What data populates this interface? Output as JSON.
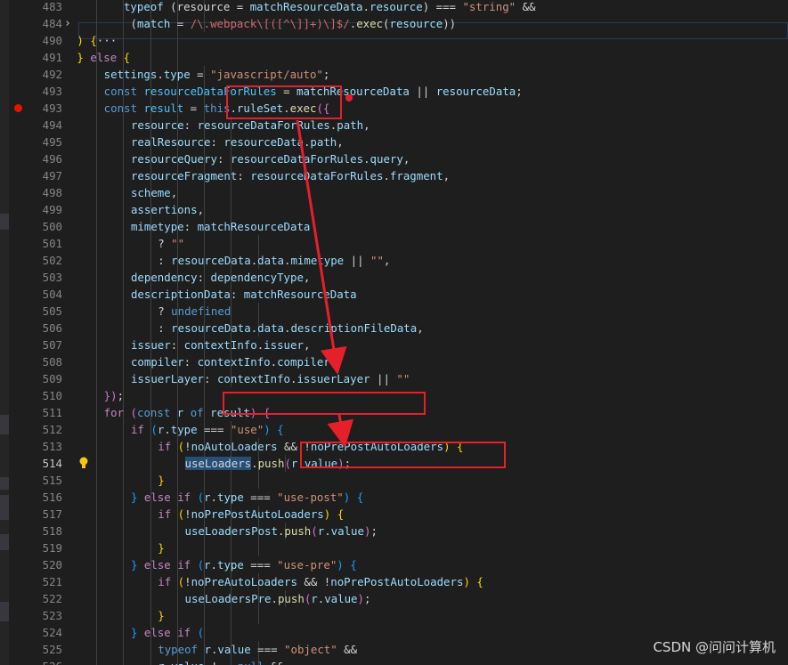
{
  "editor": {
    "lines": [
      {
        "n": "483",
        "tokens": [
          [
            "p",
            "    "
          ],
          [
            "v",
            "typeof"
          ],
          [
            "p",
            " (resource "
          ],
          [
            "p",
            "= "
          ],
          [
            "v",
            "matchResourceData"
          ],
          [
            "p",
            "."
          ],
          [
            "v",
            "resource"
          ],
          [
            "p",
            ") "
          ],
          [
            "p",
            "=== "
          ],
          [
            "s",
            "\"string\""
          ],
          [
            "p",
            " &&"
          ]
        ]
      },
      {
        "n": "484",
        "fold": "›",
        "tokens": [
          [
            "p",
            "    ("
          ],
          [
            "v",
            "match"
          ],
          [
            "p",
            " = "
          ],
          [
            "r",
            "/\\.webpack\\[([^\\]]+)\\]$/"
          ],
          [
            "p",
            "."
          ],
          [
            "f",
            "exec"
          ],
          [
            "p",
            "("
          ],
          [
            "v",
            "resource"
          ],
          [
            "p",
            "))"
          ]
        ]
      },
      {
        "n": "490",
        "tokens": [
          [
            "b1",
            ") {"
          ],
          [
            "p",
            "···"
          ]
        ]
      },
      {
        "n": "491",
        "tokens": [
          [
            "b1",
            "} "
          ],
          [
            "kc",
            "else"
          ],
          [
            "b1",
            " {"
          ]
        ]
      },
      {
        "n": "492",
        "tokens": [
          [
            "v",
            "settings"
          ],
          [
            "p",
            "."
          ],
          [
            "v",
            "type"
          ],
          [
            "p",
            " = "
          ],
          [
            "s",
            "\"javascript/auto\""
          ],
          [
            "p",
            ";"
          ]
        ]
      },
      {
        "n": "493",
        "tokens": [
          [
            "k",
            "const"
          ],
          [
            "p",
            " "
          ],
          [
            "cst",
            "resourceDataForRules"
          ],
          [
            "p",
            " = "
          ],
          [
            "v",
            "matchResourceData"
          ],
          [
            "p",
            " || "
          ],
          [
            "v",
            "resourceData"
          ],
          [
            "p",
            ";"
          ]
        ]
      },
      {
        "n": "493",
        "bp": true,
        "tokens": [
          [
            "k",
            "const"
          ],
          [
            "p",
            " "
          ],
          [
            "cst",
            "result"
          ],
          [
            "p",
            " = "
          ],
          [
            "k",
            "this"
          ],
          [
            "p",
            "."
          ],
          [
            "v",
            "ruleSet"
          ],
          [
            "p",
            "."
          ],
          [
            "f",
            "exec"
          ],
          [
            "b2",
            "({"
          ]
        ]
      },
      {
        "n": "494",
        "tokens": [
          [
            "v",
            "resource"
          ],
          [
            "p",
            ": "
          ],
          [
            "v",
            "resourceDataForRules"
          ],
          [
            "p",
            "."
          ],
          [
            "v",
            "path"
          ],
          [
            "p",
            ","
          ]
        ]
      },
      {
        "n": "495",
        "tokens": [
          [
            "v",
            "realResource"
          ],
          [
            "p",
            ": "
          ],
          [
            "v",
            "resourceData"
          ],
          [
            "p",
            "."
          ],
          [
            "v",
            "path"
          ],
          [
            "p",
            ","
          ]
        ]
      },
      {
        "n": "496",
        "tokens": [
          [
            "v",
            "resourceQuery"
          ],
          [
            "p",
            ": "
          ],
          [
            "v",
            "resourceDataForRules"
          ],
          [
            "p",
            "."
          ],
          [
            "v",
            "query"
          ],
          [
            "p",
            ","
          ]
        ]
      },
      {
        "n": "497",
        "tokens": [
          [
            "v",
            "resourceFragment"
          ],
          [
            "p",
            ": "
          ],
          [
            "v",
            "resourceDataForRules"
          ],
          [
            "p",
            "."
          ],
          [
            "v",
            "fragment"
          ],
          [
            "p",
            ","
          ]
        ]
      },
      {
        "n": "498",
        "tokens": [
          [
            "v",
            "scheme"
          ],
          [
            "p",
            ","
          ]
        ]
      },
      {
        "n": "499",
        "tokens": [
          [
            "v",
            "assertions"
          ],
          [
            "p",
            ","
          ]
        ]
      },
      {
        "n": "500",
        "tokens": [
          [
            "v",
            "mimetype"
          ],
          [
            "p",
            ": "
          ],
          [
            "v",
            "matchResourceData"
          ]
        ]
      },
      {
        "n": "501",
        "tokens": [
          [
            "p",
            "? "
          ],
          [
            "s",
            "\"\""
          ]
        ]
      },
      {
        "n": "502",
        "tokens": [
          [
            "p",
            ": "
          ],
          [
            "v",
            "resourceData"
          ],
          [
            "p",
            "."
          ],
          [
            "v",
            "data"
          ],
          [
            "p",
            "."
          ],
          [
            "v",
            "mimetype"
          ],
          [
            "p",
            " || "
          ],
          [
            "s",
            "\"\""
          ],
          [
            "p",
            ","
          ]
        ]
      },
      {
        "n": "503",
        "tokens": [
          [
            "v",
            "dependency"
          ],
          [
            "p",
            ": "
          ],
          [
            "v",
            "dependencyType"
          ],
          [
            "p",
            ","
          ]
        ]
      },
      {
        "n": "504",
        "tokens": [
          [
            "v",
            "descriptionData"
          ],
          [
            "p",
            ": "
          ],
          [
            "v",
            "matchResourceData"
          ]
        ]
      },
      {
        "n": "505",
        "tokens": [
          [
            "p",
            "? "
          ],
          [
            "k",
            "undefined"
          ]
        ]
      },
      {
        "n": "506",
        "tokens": [
          [
            "p",
            ": "
          ],
          [
            "v",
            "resourceData"
          ],
          [
            "p",
            "."
          ],
          [
            "v",
            "data"
          ],
          [
            "p",
            "."
          ],
          [
            "v",
            "descriptionFileData"
          ],
          [
            "p",
            ","
          ]
        ]
      },
      {
        "n": "507",
        "tokens": [
          [
            "v",
            "issuer"
          ],
          [
            "p",
            ": "
          ],
          [
            "v",
            "contextInfo"
          ],
          [
            "p",
            "."
          ],
          [
            "v",
            "issuer"
          ],
          [
            "p",
            ","
          ]
        ]
      },
      {
        "n": "508",
        "tokens": [
          [
            "v",
            "compiler"
          ],
          [
            "p",
            ": "
          ],
          [
            "v",
            "contextInfo"
          ],
          [
            "p",
            "."
          ],
          [
            "v",
            "compiler"
          ],
          [
            "p",
            ","
          ]
        ]
      },
      {
        "n": "509",
        "tokens": [
          [
            "v",
            "issuerLayer"
          ],
          [
            "p",
            ": "
          ],
          [
            "v",
            "contextInfo"
          ],
          [
            "p",
            "."
          ],
          [
            "v",
            "issuerLayer"
          ],
          [
            "p",
            " || "
          ],
          [
            "s",
            "\"\""
          ]
        ]
      },
      {
        "n": "510",
        "tokens": [
          [
            "b2",
            "})"
          ],
          [
            "p",
            ";"
          ]
        ]
      },
      {
        "n": "511",
        "tokens": [
          [
            "kc",
            "for"
          ],
          [
            "p",
            " "
          ],
          [
            "b2",
            "("
          ],
          [
            "k",
            "const"
          ],
          [
            "p",
            " "
          ],
          [
            "v",
            "r"
          ],
          [
            "p",
            " "
          ],
          [
            "k",
            "of"
          ],
          [
            "p",
            " "
          ],
          [
            "v",
            "result"
          ],
          [
            "b2",
            ")"
          ],
          [
            "p",
            " "
          ],
          [
            "b2",
            "{"
          ]
        ]
      },
      {
        "n": "512",
        "tokens": [
          [
            "kc",
            "if"
          ],
          [
            "p",
            " "
          ],
          [
            "b3",
            "("
          ],
          [
            "v",
            "r"
          ],
          [
            "p",
            "."
          ],
          [
            "v",
            "type"
          ],
          [
            "p",
            " === "
          ],
          [
            "s",
            "\"use\""
          ],
          [
            "b3",
            ")"
          ],
          [
            "p",
            " "
          ],
          [
            "b3",
            "{"
          ]
        ]
      },
      {
        "n": "513",
        "tokens": [
          [
            "kc",
            "if"
          ],
          [
            "p",
            " "
          ],
          [
            "b1",
            "("
          ],
          [
            "p",
            "!"
          ],
          [
            "v",
            "noAutoLoaders"
          ],
          [
            "p",
            " && !"
          ],
          [
            "v",
            "noPrePostAutoLoaders"
          ],
          [
            "b1",
            ")"
          ],
          [
            "p",
            " "
          ],
          [
            "b1",
            "{"
          ]
        ]
      },
      {
        "n": "514",
        "active": true,
        "bulb": true,
        "tokens": [
          [
            "hl",
            "useLoaders"
          ],
          [
            "p",
            "."
          ],
          [
            "f",
            "push"
          ],
          [
            "b2",
            "("
          ],
          [
            "v",
            "r"
          ],
          [
            "p",
            "."
          ],
          [
            "v",
            "value"
          ],
          [
            "b2",
            ")"
          ],
          [
            "p",
            ";"
          ]
        ]
      },
      {
        "n": "515",
        "tokens": [
          [
            "b1",
            "}"
          ]
        ]
      },
      {
        "n": "516",
        "tokens": [
          [
            "b3",
            "}"
          ],
          [
            "p",
            " "
          ],
          [
            "kc",
            "else if"
          ],
          [
            "p",
            " "
          ],
          [
            "b3",
            "("
          ],
          [
            "v",
            "r"
          ],
          [
            "p",
            "."
          ],
          [
            "v",
            "type"
          ],
          [
            "p",
            " === "
          ],
          [
            "s",
            "\"use-post\""
          ],
          [
            "b3",
            ")"
          ],
          [
            "p",
            " "
          ],
          [
            "b3",
            "{"
          ]
        ]
      },
      {
        "n": "517",
        "tokens": [
          [
            "kc",
            "if"
          ],
          [
            "p",
            " "
          ],
          [
            "b1",
            "("
          ],
          [
            "p",
            "!"
          ],
          [
            "v",
            "noPrePostAutoLoaders"
          ],
          [
            "b1",
            ")"
          ],
          [
            "p",
            " "
          ],
          [
            "b1",
            "{"
          ]
        ]
      },
      {
        "n": "518",
        "tokens": [
          [
            "v",
            "useLoadersPost"
          ],
          [
            "p",
            "."
          ],
          [
            "f",
            "push"
          ],
          [
            "b2",
            "("
          ],
          [
            "v",
            "r"
          ],
          [
            "p",
            "."
          ],
          [
            "v",
            "value"
          ],
          [
            "b2",
            ")"
          ],
          [
            "p",
            ";"
          ]
        ]
      },
      {
        "n": "519",
        "tokens": [
          [
            "b1",
            "}"
          ]
        ]
      },
      {
        "n": "520",
        "tokens": [
          [
            "b3",
            "}"
          ],
          [
            "p",
            " "
          ],
          [
            "kc",
            "else if"
          ],
          [
            "p",
            " "
          ],
          [
            "b3",
            "("
          ],
          [
            "v",
            "r"
          ],
          [
            "p",
            "."
          ],
          [
            "v",
            "type"
          ],
          [
            "p",
            " === "
          ],
          [
            "s",
            "\"use-pre\""
          ],
          [
            "b3",
            ")"
          ],
          [
            "p",
            " "
          ],
          [
            "b3",
            "{"
          ]
        ]
      },
      {
        "n": "521",
        "tokens": [
          [
            "kc",
            "if"
          ],
          [
            "p",
            " "
          ],
          [
            "b1",
            "("
          ],
          [
            "p",
            "!"
          ],
          [
            "v",
            "noPreAutoLoaders"
          ],
          [
            "p",
            " && !"
          ],
          [
            "v",
            "noPrePostAutoLoaders"
          ],
          [
            "b1",
            ")"
          ],
          [
            "p",
            " "
          ],
          [
            "b1",
            "{"
          ]
        ]
      },
      {
        "n": "522",
        "tokens": [
          [
            "v",
            "useLoadersPre"
          ],
          [
            "p",
            "."
          ],
          [
            "f",
            "push"
          ],
          [
            "b2",
            "("
          ],
          [
            "v",
            "r"
          ],
          [
            "p",
            "."
          ],
          [
            "v",
            "value"
          ],
          [
            "b2",
            ")"
          ],
          [
            "p",
            ";"
          ]
        ]
      },
      {
        "n": "523",
        "tokens": [
          [
            "b1",
            "}"
          ]
        ]
      },
      {
        "n": "524",
        "tokens": [
          [
            "b3",
            "}"
          ],
          [
            "p",
            " "
          ],
          [
            "kc",
            "else if"
          ],
          [
            "p",
            " "
          ],
          [
            "b3",
            "("
          ]
        ]
      },
      {
        "n": "525",
        "tokens": [
          [
            "k",
            "typeof"
          ],
          [
            "p",
            " "
          ],
          [
            "v",
            "r"
          ],
          [
            "p",
            "."
          ],
          [
            "v",
            "value"
          ],
          [
            "p",
            " === "
          ],
          [
            "s",
            "\"object\""
          ],
          [
            "p",
            " &&"
          ]
        ]
      },
      {
        "n": "526",
        "tokens": [
          [
            "v",
            "r"
          ],
          [
            "p",
            "."
          ],
          [
            "v",
            "value"
          ],
          [
            "p",
            " !== "
          ],
          [
            "k",
            "null"
          ],
          [
            "p",
            " &&"
          ]
        ]
      }
    ]
  },
  "watermark": "CSDN @问问计算机"
}
